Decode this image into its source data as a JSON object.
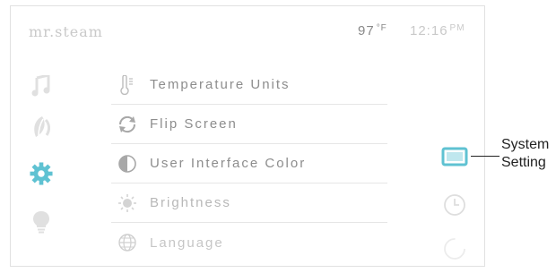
{
  "header": {
    "brand": "mr.steam",
    "temperature_value": "97",
    "temperature_unit": "°F",
    "time": "12:16",
    "ampm": "PM"
  },
  "left_nav": {
    "items": [
      {
        "icon": "music-note-icon",
        "active": false
      },
      {
        "icon": "aroma-leaf-icon",
        "active": false
      },
      {
        "icon": "gear-icon",
        "active": true
      },
      {
        "icon": "lightbulb-icon",
        "active": false
      }
    ]
  },
  "settings": {
    "items": [
      {
        "label": "Temperature Units",
        "icon": "thermometer-icon"
      },
      {
        "label": "Flip Screen",
        "icon": "rotate-icon"
      },
      {
        "label": "User Interface Color",
        "icon": "contrast-icon"
      },
      {
        "label": "Brightness",
        "icon": "sun-icon"
      },
      {
        "label": "Language",
        "icon": "globe-icon"
      }
    ]
  },
  "right_nav": {
    "items": [
      {
        "icon": "screen-settings-icon",
        "active": true
      },
      {
        "icon": "clock-icon",
        "active": false
      },
      {
        "icon": "refresh-icon",
        "active": false
      }
    ]
  },
  "annotation": {
    "line1": "System",
    "line2": "Setting"
  },
  "colors": {
    "accent": "#5fc2d2",
    "inactive_icon": "#e0e0e0",
    "text": "#8d8d8d",
    "divider": "#e6e6e6"
  }
}
